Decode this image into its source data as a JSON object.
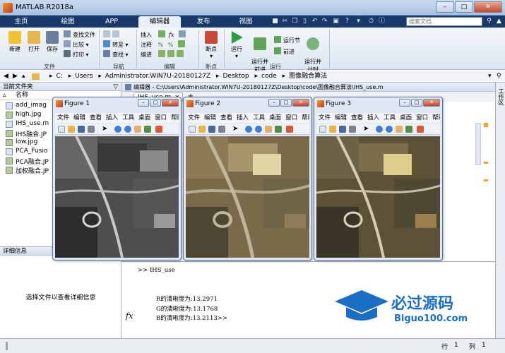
{
  "app": {
    "title": "MATLAB R2018a"
  },
  "tabs": [
    "主页",
    "绘图",
    "APP",
    "编辑器",
    "发布",
    "视图"
  ],
  "search": {
    "placeholder": "搜索文档"
  },
  "ribbon": {
    "file_group": {
      "label": "文件",
      "new": "新建",
      "open": "打开",
      "save": "保存",
      "find_files": "查找文件",
      "compare": "比较",
      "print": "打印"
    },
    "nav_group": {
      "label": "导航",
      "go_to": "转至",
      "find": "查找"
    },
    "edit_group": {
      "label": "编辑",
      "insert": "插入",
      "comment": "注释",
      "indent": "缩进"
    },
    "breakpoints_group": {
      "label": "断点",
      "breakpoints": "断点"
    },
    "run_group": {
      "label": "运行",
      "run": "运行",
      "run_advance": "运行并\n前进",
      "run_section": "运行节",
      "advance": "前进",
      "run_time": "运行并\n计时"
    }
  },
  "address": {
    "path": [
      "C:",
      "Users",
      "Administrator.WIN7U-20180127Z",
      "Desktop",
      "code",
      "图像融合算法"
    ]
  },
  "current_folder": {
    "title": "当前文件夹",
    "column": "名称",
    "files": [
      "add_imag",
      "high.jpg",
      "IHS_use.m",
      "IHS融合.JP",
      "low.jpg",
      "PCA_Fusio",
      "PCA融合.JP",
      "加权融合.JP"
    ]
  },
  "editor": {
    "title": "编辑器 - C:\\Users\\Administrator.WIN7U-20180127Z\\Desktop\\code\\图像融合算法\\IHS_use.m",
    "tab": "IHS_use.m",
    "add_tab": "+"
  },
  "figures": [
    {
      "title": "Figure 1",
      "menu": [
        "文件",
        "编辑",
        "查看",
        "插入",
        "工具",
        "桌面",
        "窗口",
        "帮助"
      ]
    },
    {
      "title": "Figure 2",
      "menu": [
        "文件",
        "编辑",
        "查看",
        "插入",
        "工具",
        "桌面",
        "窗口",
        "帮助"
      ]
    },
    {
      "title": "Figure 3",
      "menu": [
        "文件",
        "编辑",
        "查看",
        "插入",
        "工具",
        "桌面",
        "窗口",
        "帮助"
      ]
    }
  ],
  "details": {
    "title": "详细信息",
    "message": "选择文件以查看详细信息"
  },
  "command_window": {
    "prompt": ">> IHS_use",
    "lines": [
      "R的清晰度为:13.2971",
      "G的清晰度为:13.1768",
      "B的清晰度为:13.2113>>"
    ],
    "fx": "fx"
  },
  "status": {
    "row_label": "行",
    "row": "1",
    "col_label": "列",
    "col": "1"
  },
  "watermark": {
    "text": "必过源码",
    "url": "Biguo100.com"
  }
}
